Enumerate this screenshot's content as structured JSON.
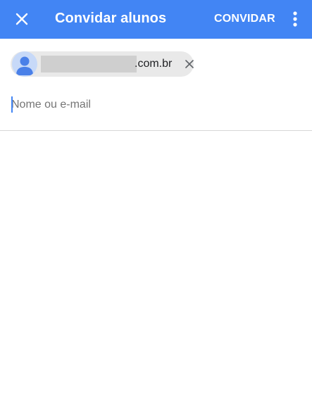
{
  "app_bar": {
    "title": "Convidar alunos",
    "action_label": "CONVIDAR",
    "close_icon": "close-icon",
    "overflow_icon": "more-vert-icon",
    "color": "#4285f4"
  },
  "recipients": [
    {
      "label_suffix": ".com.br",
      "avatar_icon": "person-icon",
      "remove_icon": "close-icon"
    }
  ],
  "input": {
    "placeholder": "Nome ou e-mail",
    "value": ""
  }
}
